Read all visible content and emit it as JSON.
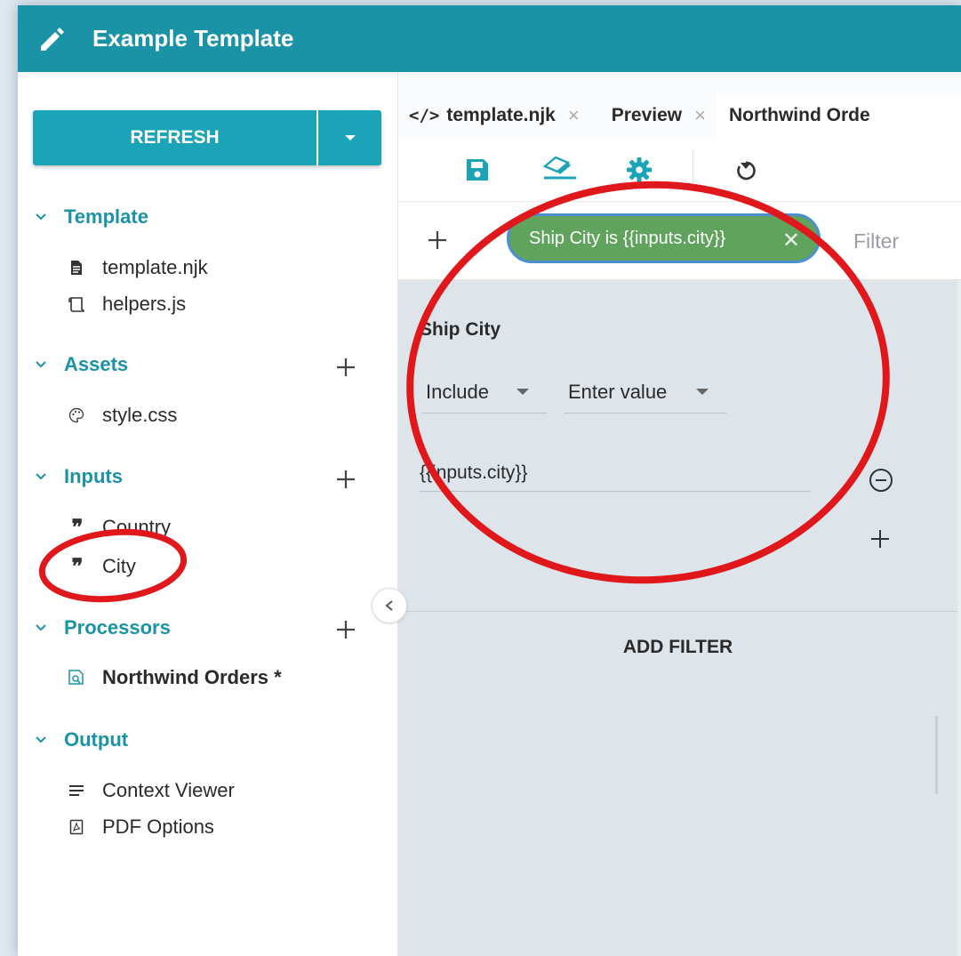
{
  "app": {
    "title": "Example Template",
    "header_color": "#1b93a6",
    "accent_color": "#1ba4b8"
  },
  "sidebar": {
    "refresh_label": "REFRESH",
    "sections": {
      "template": {
        "label": "Template",
        "items": [
          {
            "label": "template.njk",
            "icon": "file-icon"
          },
          {
            "label": "helpers.js",
            "icon": "script-icon"
          }
        ]
      },
      "assets": {
        "label": "Assets",
        "items": [
          {
            "label": "style.css",
            "icon": "palette-icon"
          }
        ]
      },
      "inputs": {
        "label": "Inputs",
        "items": [
          {
            "label": "Country",
            "icon": "quote-icon"
          },
          {
            "label": "City",
            "icon": "quote-icon"
          }
        ]
      },
      "processors": {
        "label": "Processors",
        "items": [
          {
            "label": "Northwind Orders *",
            "icon": "search-document-icon"
          }
        ]
      },
      "output": {
        "label": "Output",
        "items": [
          {
            "label": "Context Viewer",
            "icon": "list-icon"
          },
          {
            "label": "PDF Options",
            "icon": "pdf-icon"
          }
        ]
      }
    }
  },
  "tabs": [
    {
      "label": "template.njk",
      "icon": "code-icon",
      "closable": true,
      "active": false
    },
    {
      "label": "Preview",
      "closable": true,
      "active": false
    },
    {
      "label": "Northwind Orde",
      "active": true
    }
  ],
  "toolbar": {
    "buttons": [
      "save-icon",
      "clear-format-icon",
      "gear-icon",
      "undo-icon"
    ]
  },
  "filter_bar": {
    "chip_label": "Ship City is {{inputs.city}}",
    "chip_color": "#5fa35d",
    "chip_border_color": "#4a8fd0",
    "input_placeholder": "Filter"
  },
  "filter_panel": {
    "field_label": "Ship City",
    "mode_select": "Include",
    "value_select": "Enter value",
    "value": "{{inputs.city}}",
    "add_filter_label": "ADD FILTER"
  },
  "annotations": {
    "color": "#e0171b"
  }
}
